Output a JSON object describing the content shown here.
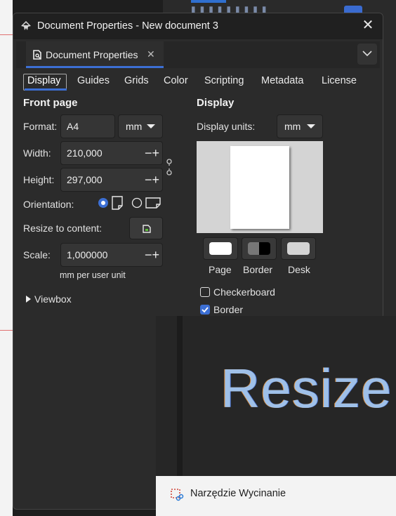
{
  "window": {
    "title": "Document Properties - New document 3",
    "tab_label": "Document Properties"
  },
  "subtabs": [
    "Display",
    "Guides",
    "Grids",
    "Color",
    "Scripting",
    "Metadata",
    "License"
  ],
  "front_page": {
    "heading": "Front page",
    "format_label": "Format:",
    "format_value": "A4",
    "format_unit": "mm",
    "width_label": "Width:",
    "width_value": "210,000",
    "height_label": "Height:",
    "height_value": "297,000",
    "orientation_label": "Orientation:",
    "orientation_selected": "portrait",
    "resize_label": "Resize to content:",
    "scale_label": "Scale:",
    "scale_value": "1,000000",
    "scale_note": "mm per user unit",
    "viewbox_label": "Viewbox"
  },
  "display": {
    "heading": "Display",
    "units_label": "Display units:",
    "units_value": "mm",
    "swatches": [
      {
        "label": "Page",
        "color": "#ffffff"
      },
      {
        "label": "Border",
        "color": "#000000"
      },
      {
        "label": "Desk",
        "color": "#d4d4d4"
      }
    ],
    "checkerboard_label": "Checkerboard",
    "checkerboard_checked": false,
    "border_label": "Border",
    "border_checked": true
  },
  "overlay": {
    "magnified_text": "Resize",
    "snip_tool_label": "Narzędzie Wycinanie"
  },
  "colors": {
    "accent": "#3c6fd4",
    "panel_bg": "#2b2b2b"
  }
}
